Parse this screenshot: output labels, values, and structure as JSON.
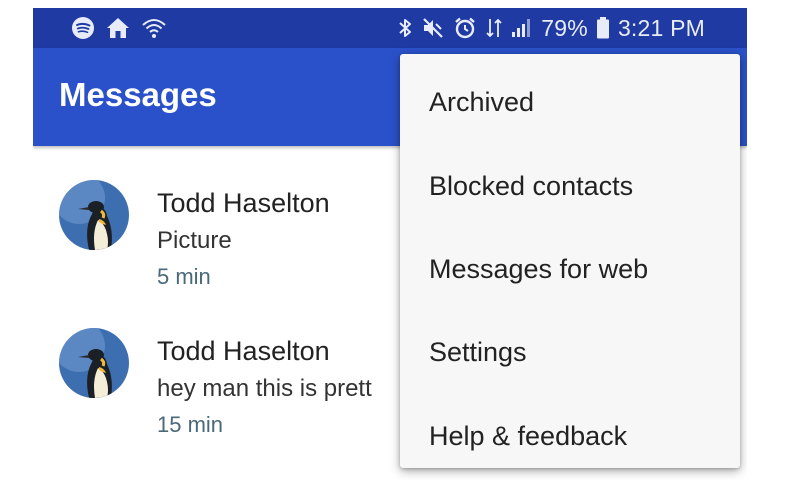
{
  "status_bar": {
    "left_icons": [
      "spotify-icon",
      "home-icon",
      "wifi-icon"
    ],
    "right_icons": [
      "bluetooth-icon",
      "mute-icon",
      "alarm-icon",
      "data-icon",
      "signal-icon"
    ],
    "battery_percent": "79%",
    "time": "3:21 PM"
  },
  "app_bar": {
    "title": "Messages"
  },
  "conversations": [
    {
      "name": "Todd Haselton",
      "snippet": "Picture",
      "time": "5 min",
      "avatar": "penguin-avatar"
    },
    {
      "name": "Todd Haselton",
      "snippet": "hey man this is prett",
      "time": "15 min",
      "avatar": "penguin-avatar"
    }
  ],
  "menu": {
    "items": [
      {
        "label": "Archived"
      },
      {
        "label": "Blocked contacts"
      },
      {
        "label": "Messages for web"
      },
      {
        "label": "Settings"
      },
      {
        "label": "Help & feedback"
      }
    ]
  },
  "colors": {
    "status_bar": "#1f3aa3",
    "app_bar": "#2a51c9",
    "menu_background": "#f7f7f7",
    "time_text": "#4a6a7a"
  }
}
